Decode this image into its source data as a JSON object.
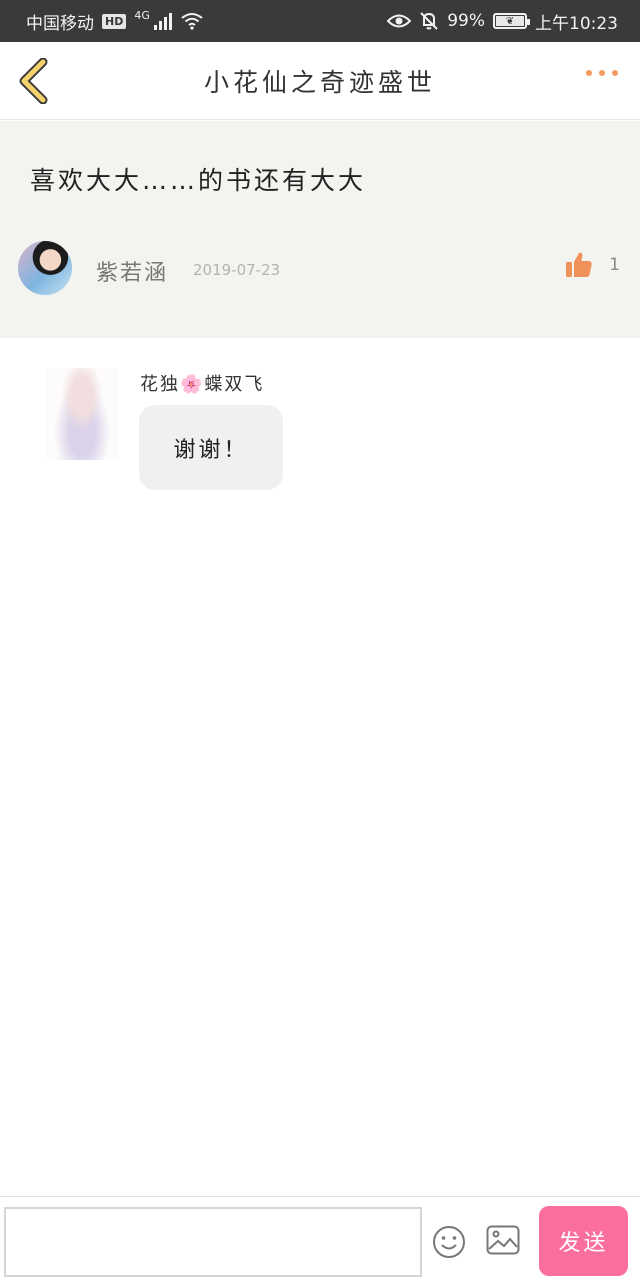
{
  "status_bar": {
    "carrier": "中国移动",
    "hd": "HD",
    "network": "4G",
    "battery": "99%",
    "time": "上午10:23"
  },
  "header": {
    "title": "小花仙之奇迹盛世"
  },
  "comment": {
    "text": "喜欢大大……的书还有大大",
    "author": "紫若涵",
    "date": "2019-07-23",
    "likes": "1"
  },
  "reply": {
    "author_prefix": "花独",
    "author_flower": "🌸",
    "author_suffix": "蝶双飞",
    "text": "谢谢！"
  },
  "input_bar": {
    "placeholder": "",
    "send_label": "发送"
  },
  "colors": {
    "accent_orange": "#f29b5c",
    "send_pink": "#fb6f9d",
    "back_arrow_yellow": "#f3d26b"
  }
}
